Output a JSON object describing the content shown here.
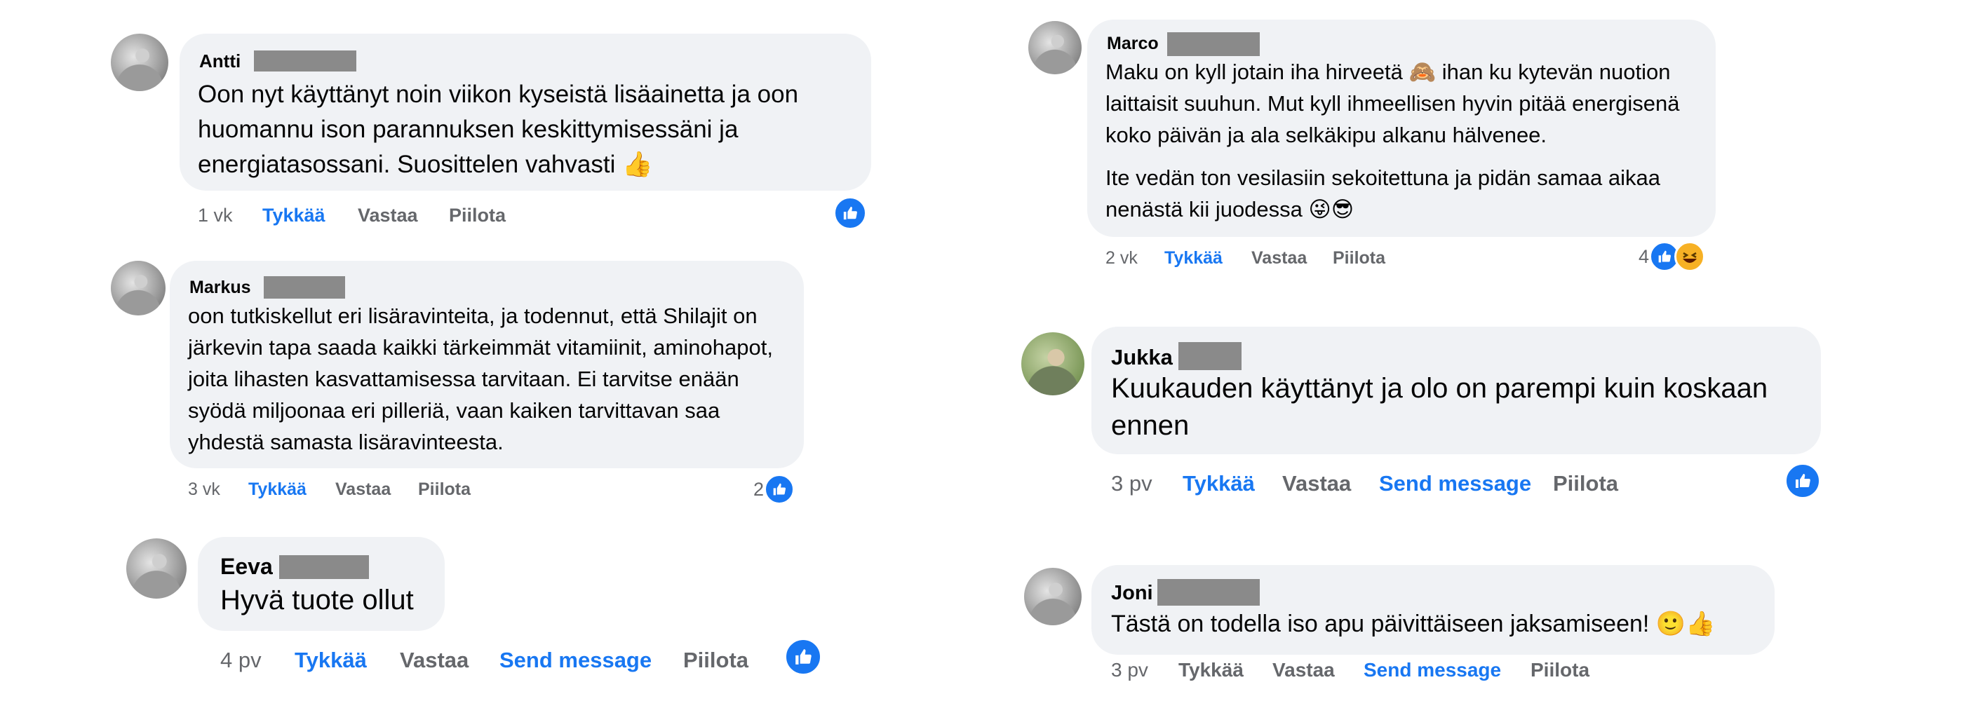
{
  "colors": {
    "bubble": "#f0f2f5",
    "like_blue": "#1877f2",
    "meta_gray": "#65676b"
  },
  "comments": [
    {
      "author": "Antti",
      "text": "Oon nyt käyttänyt noin viikon kyseistä lisäainetta ja oon huomannu ison parannuksen keskittymisessäni ja energiatasossani. Suosittelen vahvasti 👍",
      "time": "1 vk",
      "like": "Tykkää",
      "reply": "Vastaa",
      "hide": "Piilota"
    },
    {
      "author": "Markus",
      "text": "oon tutkiskellut eri lisäravinteita, ja todennut, että Shilajit on järkevin tapa saada kaikki tärkeimmät vitamiinit, aminohapot, joita lihasten kasvattamisessa tarvitaan. Ei tarvitse enään syödä miljoonaa eri pilleriä, vaan kaiken tarvittavan saa yhdestä samasta lisäravinteesta.",
      "time": "3 vk",
      "like": "Tykkää",
      "reply": "Vastaa",
      "hide": "Piilota",
      "reaction_count": "2"
    },
    {
      "author": "Eeva",
      "text": "Hyvä tuote ollut",
      "time": "4 pv",
      "like": "Tykkää",
      "reply": "Vastaa",
      "send": "Send message",
      "hide": "Piilota"
    },
    {
      "author": "Marco",
      "text": "Maku on kyll jotain iha hirveetä 🙈 ihan ku kytevän nuotion laittaisit suuhun. Mut kyll ihmeellisen hyvin pitää energisenä koko päivän ja ala selkäkipu alkanu hälvenee.",
      "text2": "Ite vedän ton vesilasiin sekoitettuna ja pidän samaa aikaa nenästä kii juodessa 😜😎",
      "time": "2 vk",
      "like": "Tykkää",
      "reply": "Vastaa",
      "hide": "Piilota",
      "reaction_count": "4"
    },
    {
      "author": "Jukka",
      "text": "Kuukauden käyttänyt ja olo on parempi kuin koskaan ennen",
      "time": "3 pv",
      "like": "Tykkää",
      "reply": "Vastaa",
      "send": "Send message",
      "hide": "Piilota"
    },
    {
      "author": "Joni",
      "text": "Tästä on todella iso apu päivittäiseen jaksamiseen! 🙂👍",
      "time": "3 pv",
      "like": "Tykkää",
      "reply": "Vastaa",
      "send": "Send message",
      "hide": "Piilota"
    }
  ]
}
